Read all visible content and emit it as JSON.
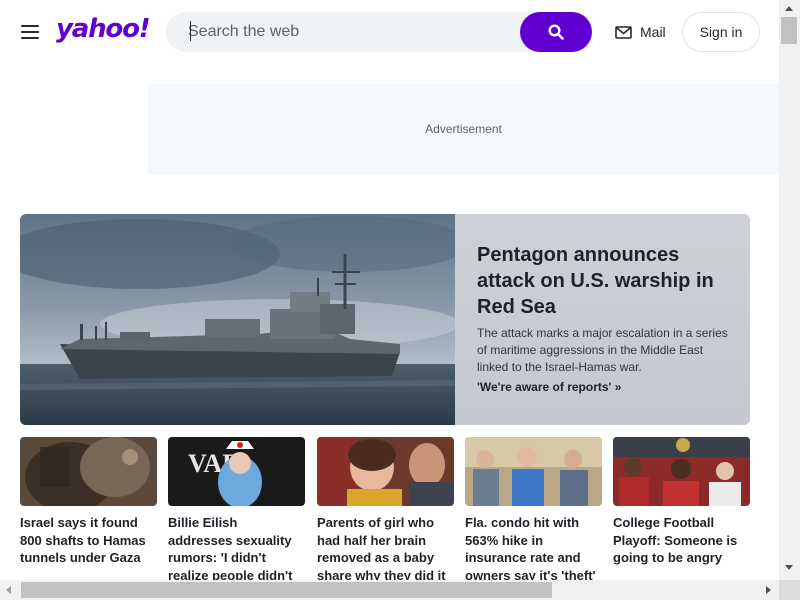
{
  "header": {
    "logo_text": "yahoo!",
    "search": {
      "placeholder": "Search the web",
      "value": ""
    },
    "mail_label": "Mail",
    "signin_label": "Sign in"
  },
  "ad": {
    "label": "Advertisement"
  },
  "hero": {
    "title": "Pentagon announces attack on U.S. warship in Red Sea",
    "description": "The attack marks a major escalation in a series of maritime aggressions in the Middle East linked to the Israel-Hamas war.",
    "link_text": "'We're aware of reports' »"
  },
  "stories": [
    {
      "title": "Israel says it found 800 shafts to Hamas tunnels under Gaza"
    },
    {
      "title": "Billie Eilish addresses sexuality rumors: 'I didn't realize people didn't know!'"
    },
    {
      "title": "Parents of girl who had half her brain removed as a baby share why they did it"
    },
    {
      "title": "Fla. condo hit with 563% hike in insurance rate and owners say it's 'theft'"
    },
    {
      "title": "College Football Playoff: Someone is going to be angry"
    }
  ],
  "icons": {
    "menu": "hamburger-menu-icon",
    "search": "search-icon",
    "mail": "mail-envelope-icon"
  },
  "colors": {
    "brand": "#6001d2",
    "text": "#232a31",
    "ad_bg": "#f5f8fa"
  }
}
